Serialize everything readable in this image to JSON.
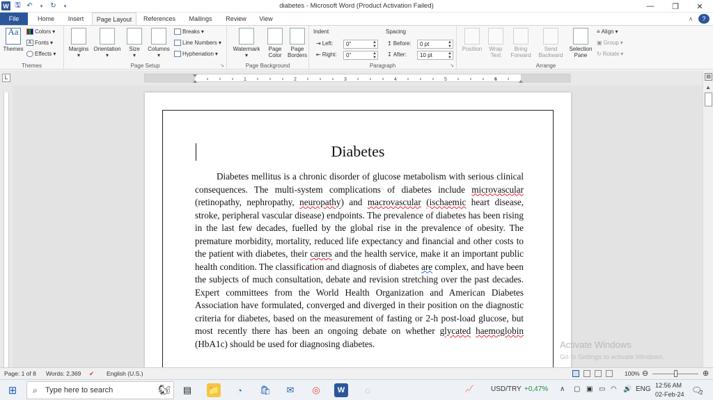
{
  "window": {
    "title": "diabetes - Microsoft Word (Product Activation Failed)",
    "quick_access": [
      "save-icon",
      "undo-icon",
      "redo-icon",
      "customize-icon"
    ]
  },
  "tabs": {
    "file": "File",
    "items": [
      "Home",
      "Insert",
      "Page Layout",
      "References",
      "Mailings",
      "Review",
      "View"
    ],
    "active": "Page Layout"
  },
  "ribbon": {
    "themes": {
      "themes_label": "Themes",
      "colors": "Colors",
      "fonts": "Fonts",
      "effects": "Effects",
      "group": "Themes"
    },
    "page_setup": {
      "margins": "Margins",
      "orientation": "Orientation",
      "size": "Size",
      "columns": "Columns",
      "breaks": "Breaks",
      "line_numbers": "Line Numbers",
      "hyphenation": "Hyphenation",
      "group": "Page Setup"
    },
    "page_background": {
      "watermark": "Watermark",
      "page_color_1": "Page",
      "page_color_2": "Color",
      "page_borders_1": "Page",
      "page_borders_2": "Borders",
      "group": "Page Background"
    },
    "paragraph": {
      "indent": "Indent",
      "left_label": "Left:",
      "left_value": "0\"",
      "right_label": "Right:",
      "right_value": "0\"",
      "spacing": "Spacing",
      "before_label": "Before:",
      "before_value": "0 pt",
      "after_label": "After:",
      "after_value": "10 pt",
      "group": "Paragraph"
    },
    "arrange": {
      "position": "Position",
      "wrap_1": "Wrap",
      "wrap_2": "Text",
      "bring_1": "Bring",
      "bring_2": "Forward",
      "send_1": "Send",
      "send_2": "Backward",
      "selection_1": "Selection",
      "selection_2": "Pane",
      "align": "Align",
      "group_btn": "Group",
      "rotate": "Rotate",
      "group": "Arrange"
    }
  },
  "document": {
    "heading": "Diabetes",
    "paragraph_parts": [
      "Diabetes mellitus is a chronic disorder of glucose metabolism with serious clinical consequences. The multi-system complications of diabetes include ",
      "microvascular",
      " (retinopathy, nephropathy, ",
      "neuropathy",
      ") and ",
      "macrovascular",
      " ",
      "(ischaemic",
      " heart disease, stroke, peripheral vascular disease) endpoints. The prevalence of diabetes has been rising in the last few decades, fuelled by the global rise in the prevalence of obesity. The premature morbidity, mortality, reduced life expectancy and financial and other costs to the patient with diabetes, their ",
      "carers",
      " and the health service, make it an important public health condition. The classification and diagnosis of diabetes ",
      "are",
      " complex, and have been the subjects of much consultation, debate and revision stretching over the past decades. Expert committees from the World Health Organization and American Diabetes Association have formulated, converged and diverged in their position on the diagnostic criteria for diabetes, based on the measurement of fasting or 2-h post-load glucose, but most recently there has been an ongoing debate on whether ",
      "glycated",
      " ",
      "haemoglobin",
      " (HbA1c) should be used for diagnosing diabetes."
    ]
  },
  "watermark": {
    "line1": "Activate Windows",
    "line2": "Go to Settings to activate Windows."
  },
  "status": {
    "page": "Page: 1 of 8",
    "words": "Words: 2,369",
    "language": "English (U.S.)",
    "zoom": "100%",
    "zoom_level": 100
  },
  "taskbar": {
    "search_placeholder": "Type here to search",
    "ticker": "USD/TRY",
    "ticker_change": "+0,47%",
    "lang": "ENG",
    "time": "12:56 AM",
    "date": "02-Feb-24",
    "notifications": "2"
  },
  "colors": {
    "accent": "#2b579a",
    "ticker_up": "#1a8f3a"
  }
}
